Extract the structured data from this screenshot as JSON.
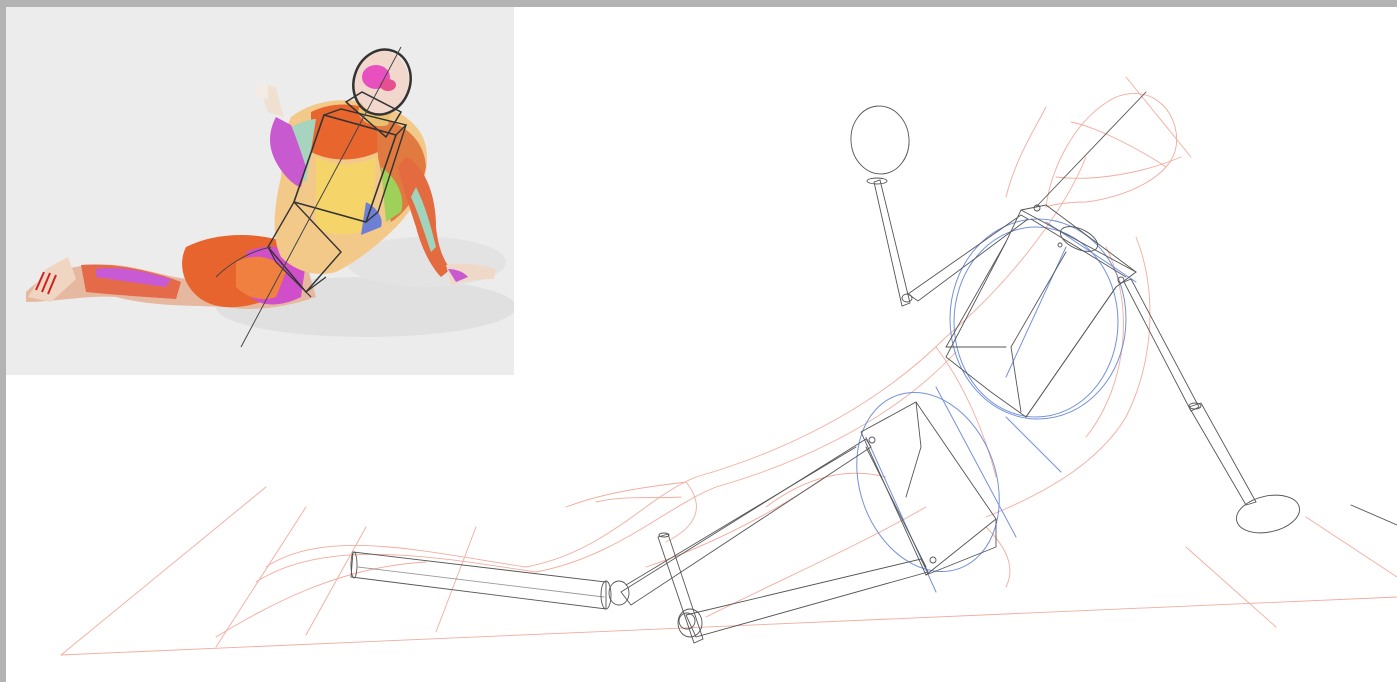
{
  "app": {
    "canvas_background": "#ffffff",
    "workspace_background": "#b3b3b3",
    "reference_background": "#ececec"
  },
  "reference_image": {
    "subject": "anatomy-muscle-figure-reclining",
    "icon": "reference-figure-icon"
  },
  "sketch": {
    "stroke_colors": {
      "construction": "#555555",
      "gesture": "#f0a090",
      "volume": "#5b7fd6"
    }
  }
}
